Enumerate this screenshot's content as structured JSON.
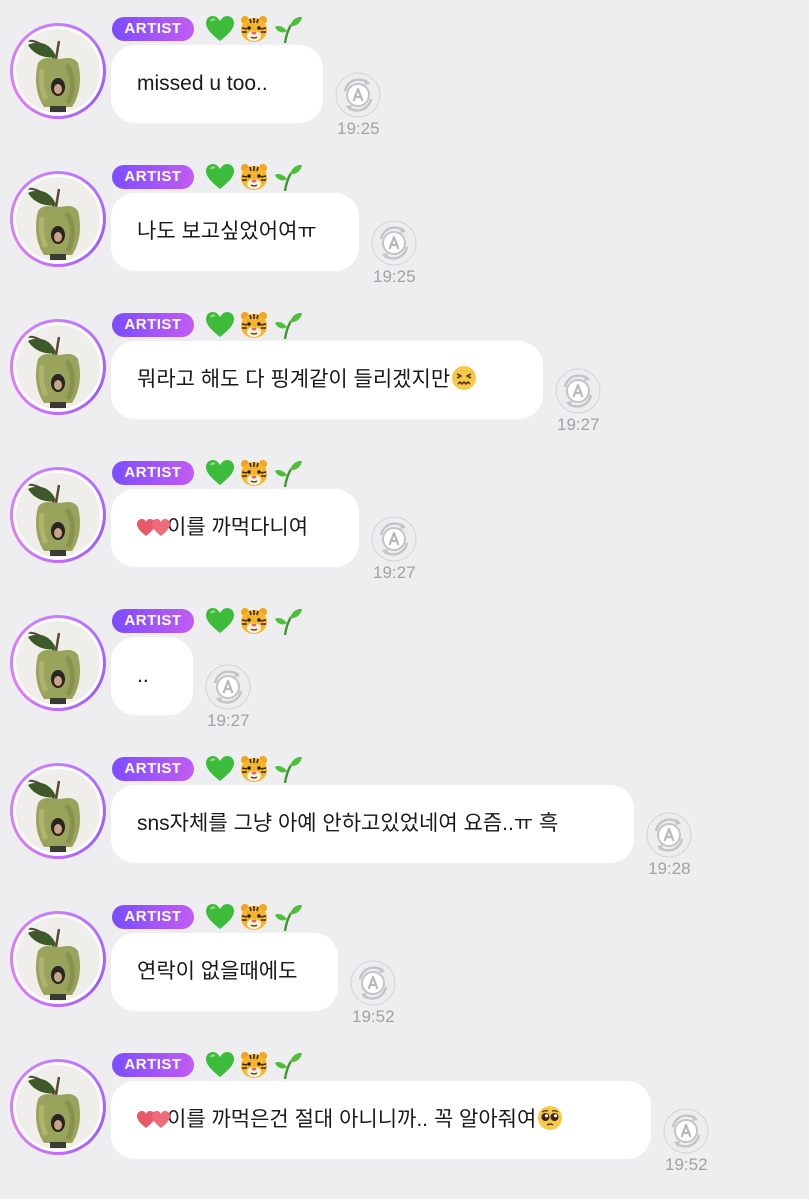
{
  "colors": {
    "background": "#eeeef0",
    "bubble": "#ffffff",
    "badge_start": "#7b4dff",
    "badge_end": "#c25cf2",
    "timestamp": "#a2a2a6",
    "translate_icon": "#c9c9cc"
  },
  "badge_emojis": [
    "green-heart-icon",
    "tiger-face-icon",
    "seedling-icon"
  ],
  "messages": [
    {
      "badge": "ARTIST",
      "text": "missed u too..",
      "time": "19:25",
      "avatar": "apple-avatar",
      "translate_icon": "translate-a-icon"
    },
    {
      "badge": "ARTIST",
      "text": "나도 보고싶었어여ㅠ",
      "time": "19:25",
      "avatar": "apple-avatar",
      "translate_icon": "translate-a-icon"
    },
    {
      "badge": "ARTIST",
      "text": "뭐라고 해도 다 핑계같이 들리겠지만",
      "trailing_emoji": "confounded-face-icon",
      "time": "19:27",
      "avatar": "apple-avatar",
      "translate_icon": "translate-a-icon"
    },
    {
      "badge": "ARTIST",
      "leading_sticker": "heart-stickers-icon",
      "text": "이를 까먹다니여",
      "time": "19:27",
      "avatar": "apple-avatar",
      "translate_icon": "translate-a-icon"
    },
    {
      "badge": "ARTIST",
      "text": "..",
      "time": "19:27",
      "avatar": "apple-avatar",
      "translate_icon": "translate-a-icon"
    },
    {
      "badge": "ARTIST",
      "text": "sns자체를 그냥 아예 안하고있었네여 요즘..ㅠ 흑",
      "time": "19:28",
      "avatar": "apple-avatar",
      "translate_icon": "translate-a-icon"
    },
    {
      "badge": "ARTIST",
      "text": "연락이 없을때에도",
      "time": "19:52",
      "avatar": "apple-avatar",
      "translate_icon": "translate-a-icon"
    },
    {
      "badge": "ARTIST",
      "leading_sticker": "heart-stickers-icon",
      "text": "이를 까먹은건 절대 아니니까.. 꼭 알아줘여",
      "trailing_emoji": "pleading-face-icon",
      "time": "19:52",
      "avatar": "apple-avatar",
      "translate_icon": "translate-a-icon"
    }
  ]
}
